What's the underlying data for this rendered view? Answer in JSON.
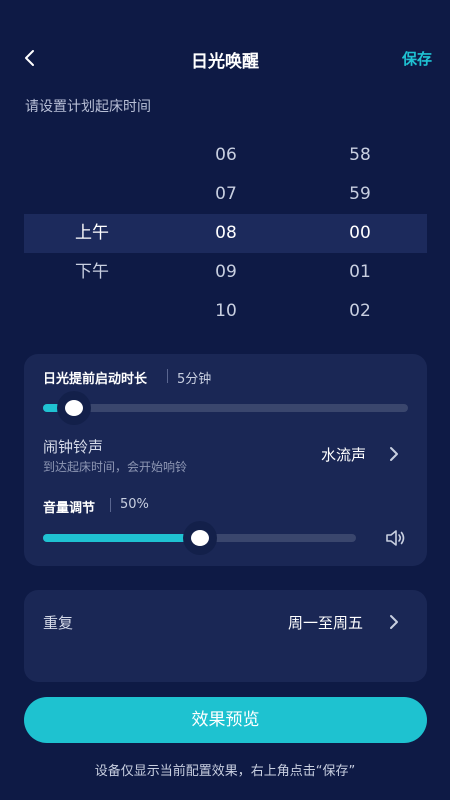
{
  "header": {
    "title": "日光唤醒",
    "save_label": "保存",
    "back_icon": "chevron-left-icon"
  },
  "instruction": "请设置计划起床时间",
  "time_picker": {
    "ampm": [
      "",
      "",
      "上午",
      "下午",
      ""
    ],
    "hours": [
      "06",
      "07",
      "08",
      "09",
      "10"
    ],
    "minutes": [
      "58",
      "59",
      "00",
      "01",
      "02"
    ],
    "selected": {
      "ampm": "上午",
      "hour": "08",
      "minute": "00"
    }
  },
  "sunlight": {
    "label": "日光提前启动时长",
    "value": "5分钟",
    "level_fraction": 0.085
  },
  "alarm": {
    "title": "闹钟铃声",
    "subtitle": "到达起床时间，会开始响铃",
    "value": "水流声"
  },
  "volume": {
    "label": "音量调节",
    "value": "50%",
    "level_fraction": 0.5,
    "icon": "speaker-icon"
  },
  "repeat": {
    "label": "重复",
    "value": "周一至周五"
  },
  "preview_button": "效果预览",
  "footer_note": "设备仅显示当前配置效果，右上角点击“保存”",
  "colors": {
    "background": "#0e1a45",
    "card": "#1a2755",
    "accent": "#1fc2d2",
    "track": "#3a466d"
  }
}
